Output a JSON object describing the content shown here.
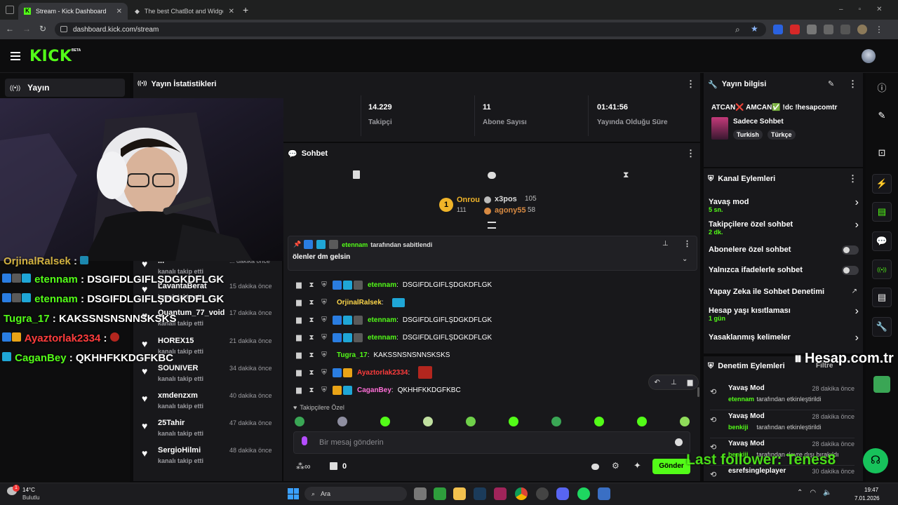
{
  "browser": {
    "tabs": [
      {
        "title": "Stream - Kick Dashboard",
        "active": true
      },
      {
        "title": "The best ChatBot and Widgets",
        "active": false
      }
    ],
    "url": "dashboard.kick.com/stream"
  },
  "header": {
    "logo": "KICK",
    "badge": "BETA"
  },
  "sidebar": {
    "nav_label": "Yayın"
  },
  "stats": {
    "title": "Yayın İstatistikleri",
    "items": [
      {
        "value": "14.229",
        "label": "Takipçi"
      },
      {
        "value": "11",
        "label": "Abone Sayısı"
      },
      {
        "value": "01:41:56",
        "label": "Yayında Olduğu Süre"
      }
    ]
  },
  "overlay": {
    "lines": [
      {
        "user": "OrjinalRalsek",
        "sep": " : ",
        "msg": ""
      },
      {
        "user": "etennam",
        "sep": " : ",
        "msg": "DSGIFDLGIFLŞDGKDFLGK"
      },
      {
        "user": "etennam",
        "sep": " : ",
        "msg": "DSGIFDLGIFLŞDGKDFLGK"
      },
      {
        "user": "Tugra_17",
        "sep": " : ",
        "msg": "KAKSSNSNSNNSKSKS"
      },
      {
        "user": "Ayaztorlak2334",
        "sep": " : ",
        "msg": ""
      },
      {
        "user": "CaganBey",
        "sep": " : ",
        "msg": "QKHHFKKDGFKBC"
      }
    ],
    "last_follower": "Last follower: Tenes8",
    "watermark": "Hesap.com.tr"
  },
  "followers": [
    {
      "name": "...",
      "sub": "kanalı takip etti",
      "time": "... dakika önce"
    },
    {
      "name": "LavantaBerat",
      "sub": "kanalı takip etti",
      "time": "15 dakika önce"
    },
    {
      "name": "Quantum_77_void",
      "sub": "kanalı takip etti",
      "time": "17 dakika önce"
    },
    {
      "name": "HOREX15",
      "sub": "kanalı takip etti",
      "time": "21 dakika önce"
    },
    {
      "name": "SOUNIVER",
      "sub": "kanalı takip etti",
      "time": "34 dakika önce"
    },
    {
      "name": "xmdenzxm",
      "sub": "kanalı takip etti",
      "time": "40 dakika önce"
    },
    {
      "name": "25Tahir",
      "sub": "kanalı takip etti",
      "time": "47 dakika önce"
    },
    {
      "name": "SergioHilmi",
      "sub": "kanalı takip etti",
      "time": "48 dakika önce"
    }
  ],
  "chat": {
    "title": "Sohbet",
    "leaders": [
      {
        "name": "Onrou",
        "count": "111"
      },
      {
        "name": "x3pos",
        "count": "105"
      },
      {
        "name": "agony55",
        "count": "58"
      }
    ],
    "pinned": {
      "by_user": "etennam",
      "by_text": "tarafından sabitlendi",
      "message": "ölenler dm gelsin"
    },
    "messages": [
      {
        "user": "etennam",
        "msg": "DSGIFDLGIFLŞDGKDFLGK",
        "color": "#53fc18"
      },
      {
        "user": "OrjinalRalsek",
        "msg": "",
        "color": "#ffd84a"
      },
      {
        "user": "etennam",
        "msg": "DSGIFDLGIFLŞDGKDFLGK",
        "color": "#53fc18"
      },
      {
        "user": "etennam",
        "msg": "DSGIFDLGIFLŞDGKDFLGK",
        "color": "#53fc18"
      },
      {
        "user": "Tugra_17",
        "msg": "KAKSSNSNSNNSKSKS",
        "color": "#53fc18"
      },
      {
        "user": "Ayaztorlak2334",
        "msg": "",
        "color": "#ff3c3c"
      },
      {
        "user": "CaganBey",
        "msg": "QKHHFKKDGFKBC",
        "color": "#ff6fd8"
      }
    ],
    "emote_section": "Takipçilere Özel",
    "input_placeholder": "Bir mesaj gönderin",
    "points": "0",
    "send_label": "Gönder"
  },
  "stream_info": {
    "title": "Yayın bilgisi",
    "stream_title": "ATCAN❌ AMCAN✅ !dc !hesapcomtr",
    "category": "Sadece Sohbet",
    "tags": [
      "Turkish",
      "Türkçe"
    ]
  },
  "channel_actions": {
    "title": "Kanal Eylemleri",
    "items": [
      {
        "label": "Yavaş mod",
        "sub": "5 sn.",
        "control": "chevron"
      },
      {
        "label": "Takipçilere özel sohbet",
        "sub": "2 dk.",
        "control": "chevron"
      },
      {
        "label": "Abonelere özel sohbet",
        "sub": "",
        "control": "toggle"
      },
      {
        "label": "Yalnızca ifadelerle sohbet",
        "sub": "",
        "control": "toggle"
      },
      {
        "label": "Yapay Zeka ile Sohbet Denetimi",
        "sub": "",
        "control": "external"
      },
      {
        "label": "Hesap yaşı kısıtlaması",
        "sub": "1 gün",
        "control": "chevron"
      },
      {
        "label": "Yasaklanmış kelimeler",
        "sub": "",
        "control": "chevron"
      }
    ]
  },
  "mod_actions": {
    "title": "Denetim Eylemleri",
    "filter": "Filtre",
    "items": [
      {
        "title": "Yavaş Mod",
        "time": "28 dakika önce",
        "user": "etennam",
        "text": "tarafından etkinleştirildi"
      },
      {
        "title": "Yavaş Mod",
        "time": "28 dakika önce",
        "user": "benkiji",
        "text": "tarafından etkinleştirildi"
      },
      {
        "title": "Yavaş Mod",
        "time": "28 dakika önce",
        "user": "benkiji",
        "text": "tarafından devre dışı bırakıldı"
      },
      {
        "title": "esrefsingleplayer",
        "time": "30 dakika önce",
        "user": "",
        "text": ""
      }
    ]
  },
  "taskbar": {
    "weather_temp": "14°C",
    "weather_desc": "Bulutlu",
    "search": "Ara",
    "time": "19:47",
    "date": "7.01.2026",
    "notif": "1"
  },
  "colors": {
    "accent": "#53fc18",
    "panel": "#18181b",
    "bg": "#0b0b0c"
  }
}
